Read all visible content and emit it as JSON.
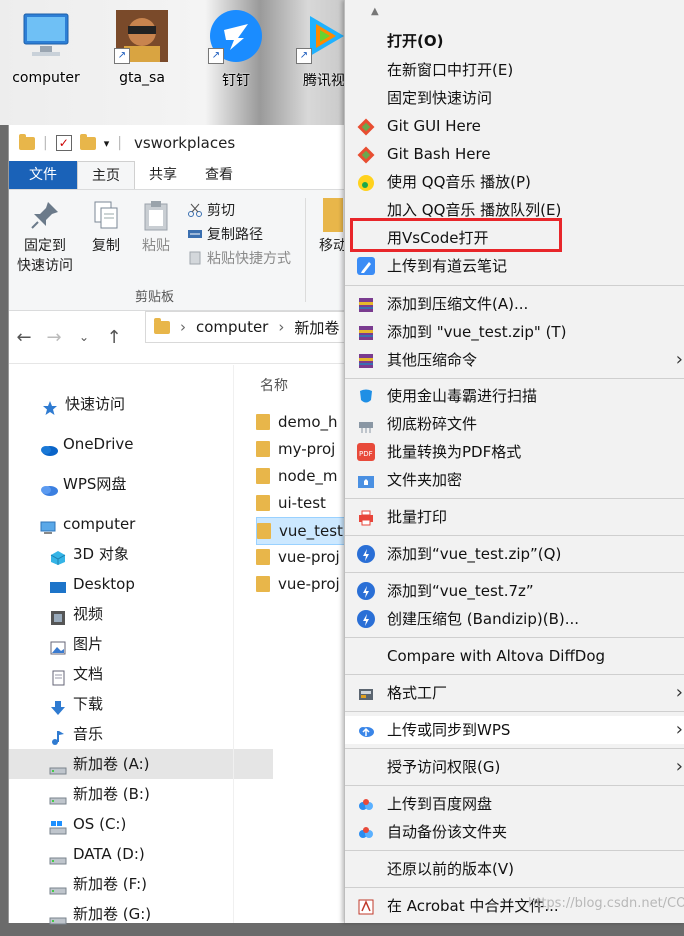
{
  "desktop": {
    "icons": [
      {
        "label": "computer"
      },
      {
        "label": "gta_sa"
      },
      {
        "label": "钉钉"
      },
      {
        "label": "腾讯视"
      }
    ]
  },
  "explorer": {
    "title": "vsworkplaces",
    "tabs": [
      {
        "label": "文件"
      },
      {
        "label": "主页"
      },
      {
        "label": "共享"
      },
      {
        "label": "查看"
      }
    ],
    "ribbon": {
      "pin_label_1": "固定到",
      "pin_label_2": "快速访问",
      "copy_label": "复制",
      "paste_label": "粘贴",
      "cut_label": "剪切",
      "copy_path_label": "复制路径",
      "paste_shortcut_label": "粘贴快捷方式",
      "move_label": "移动",
      "group_label": "剪贴板"
    },
    "breadcrumb": [
      "computer",
      "新加卷 ("
    ],
    "nav_items": [
      {
        "label": "快速访问"
      },
      {
        "label": "OneDrive"
      },
      {
        "label": "WPS网盘"
      },
      {
        "label": "computer"
      },
      {
        "label": "3D 对象"
      },
      {
        "label": "Desktop"
      },
      {
        "label": "视频"
      },
      {
        "label": "图片"
      },
      {
        "label": "文档"
      },
      {
        "label": "下载"
      },
      {
        "label": "音乐"
      },
      {
        "label": "新加卷 (A:)"
      },
      {
        "label": "新加卷 (B:)"
      },
      {
        "label": "OS (C:)"
      },
      {
        "label": "DATA (D:)"
      },
      {
        "label": "新加卷 (F:)"
      },
      {
        "label": "新加卷 (G:)"
      }
    ],
    "column_name": "名称",
    "files": [
      {
        "name": "demo_h"
      },
      {
        "name": "my-proj"
      },
      {
        "name": "node_m"
      },
      {
        "name": "ui-test"
      },
      {
        "name": "vue_test"
      },
      {
        "name": "vue-proj"
      },
      {
        "name": "vue-proj"
      }
    ]
  },
  "context_menu": {
    "items": [
      {
        "label": "打开(O)"
      },
      {
        "label": "在新窗口中打开(E)"
      },
      {
        "label": "固定到快速访问"
      },
      {
        "label": "Git GUI Here"
      },
      {
        "label": "Git Bash Here"
      },
      {
        "label": "使用 QQ音乐 播放(P)"
      },
      {
        "label": "加入 QQ音乐 播放队列(E)"
      },
      {
        "label": "用VsCode打开"
      },
      {
        "label": "上传到有道云笔记"
      },
      {
        "label": "添加到压缩文件(A)..."
      },
      {
        "label": "添加到 \"vue_test.zip\" (T)"
      },
      {
        "label": "其他压缩命令"
      },
      {
        "label": "使用金山毒霸进行扫描"
      },
      {
        "label": "彻底粉碎文件"
      },
      {
        "label": "批量转换为PDF格式"
      },
      {
        "label": "文件夹加密"
      },
      {
        "label": "批量打印"
      },
      {
        "label": "添加到“vue_test.zip”(Q)"
      },
      {
        "label": "添加到“vue_test.7z”"
      },
      {
        "label": "创建压缩包 (Bandizip)(B)..."
      },
      {
        "label": "Compare with Altova DiffDog"
      },
      {
        "label": "格式工厂"
      },
      {
        "label": "上传或同步到WPS"
      },
      {
        "label": "授予访问权限(G)"
      },
      {
        "label": "上传到百度网盘"
      },
      {
        "label": "自动备份该文件夹"
      },
      {
        "label": "还原以前的版本(V)"
      },
      {
        "label": "在 Acrobat 中合并文件..."
      }
    ]
  },
  "watermark": "https://blog.csdn.net/CO_LA_",
  "colors": {
    "highlight_box": "#e8262a",
    "file_tab": "#1a62b8",
    "selection": "#cce8ff"
  }
}
